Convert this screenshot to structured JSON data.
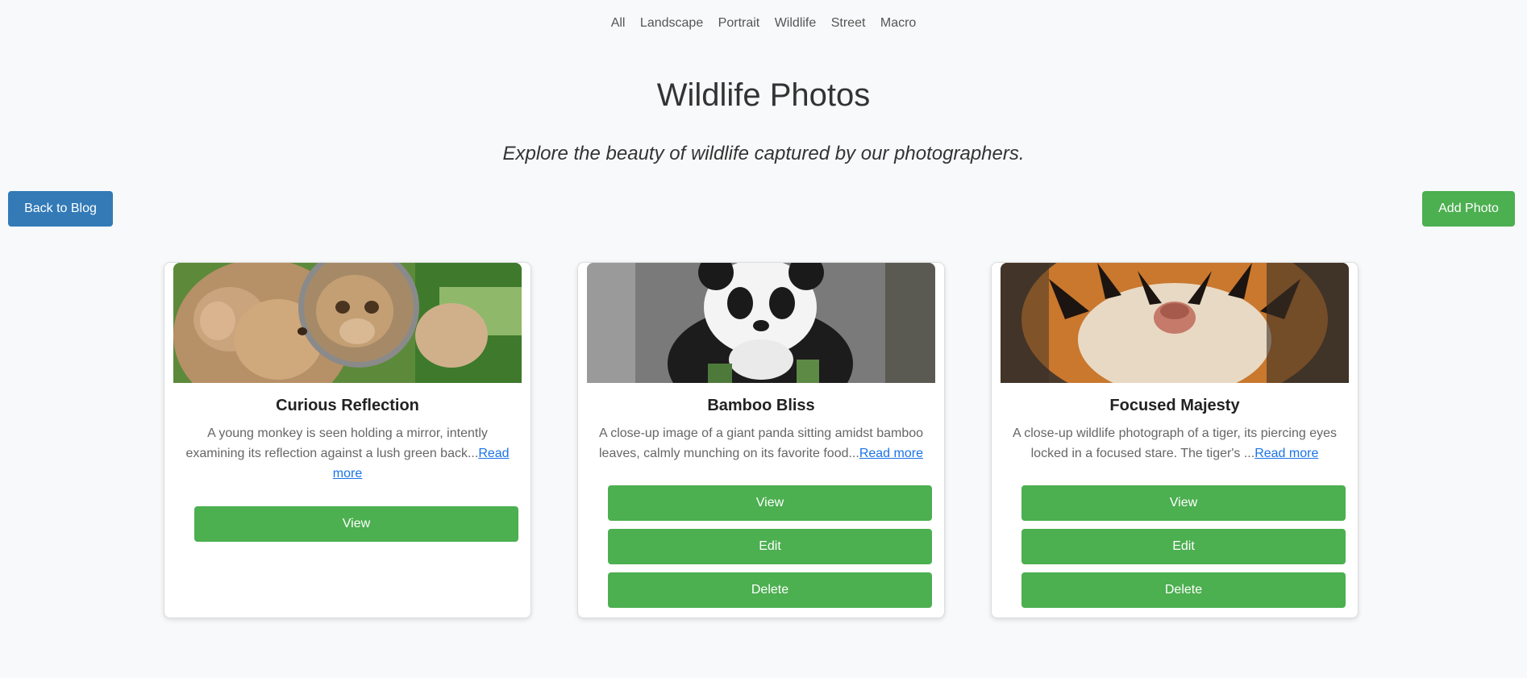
{
  "nav": {
    "items": [
      "All",
      "Landscape",
      "Portrait",
      "Wildlife",
      "Street",
      "Macro"
    ]
  },
  "header": {
    "title": "Wildlife Photos",
    "subtitle": "Explore the beauty of wildlife captured by our photographers.",
    "back_label": "Back to Blog",
    "add_label": "Add Photo"
  },
  "cards": [
    {
      "title": "Curious Reflection",
      "description": "A young monkey is seen holding a mirror, intently examining its reflection against a lush green back...",
      "read_more": "Read more",
      "image_icon": "monkey-photo",
      "buttons": [
        "View"
      ]
    },
    {
      "title": "Bamboo Bliss",
      "description": "A close-up image of a giant panda sitting amidst bamboo leaves, calmly munching on its favorite food...",
      "read_more": "Read more",
      "image_icon": "panda-photo",
      "buttons": [
        "View",
        "Edit",
        "Delete"
      ]
    },
    {
      "title": "Focused Majesty",
      "description": "A close-up wildlife photograph of a tiger, its piercing eyes locked in a focused stare. The tiger's ...",
      "read_more": "Read more",
      "image_icon": "tiger-photo",
      "buttons": [
        "View",
        "Edit",
        "Delete"
      ]
    }
  ],
  "colors": {
    "primary_blue": "#337ab7",
    "action_green": "#4caf50",
    "link_blue": "#1a73e8",
    "page_background": "#f8f9fa"
  }
}
